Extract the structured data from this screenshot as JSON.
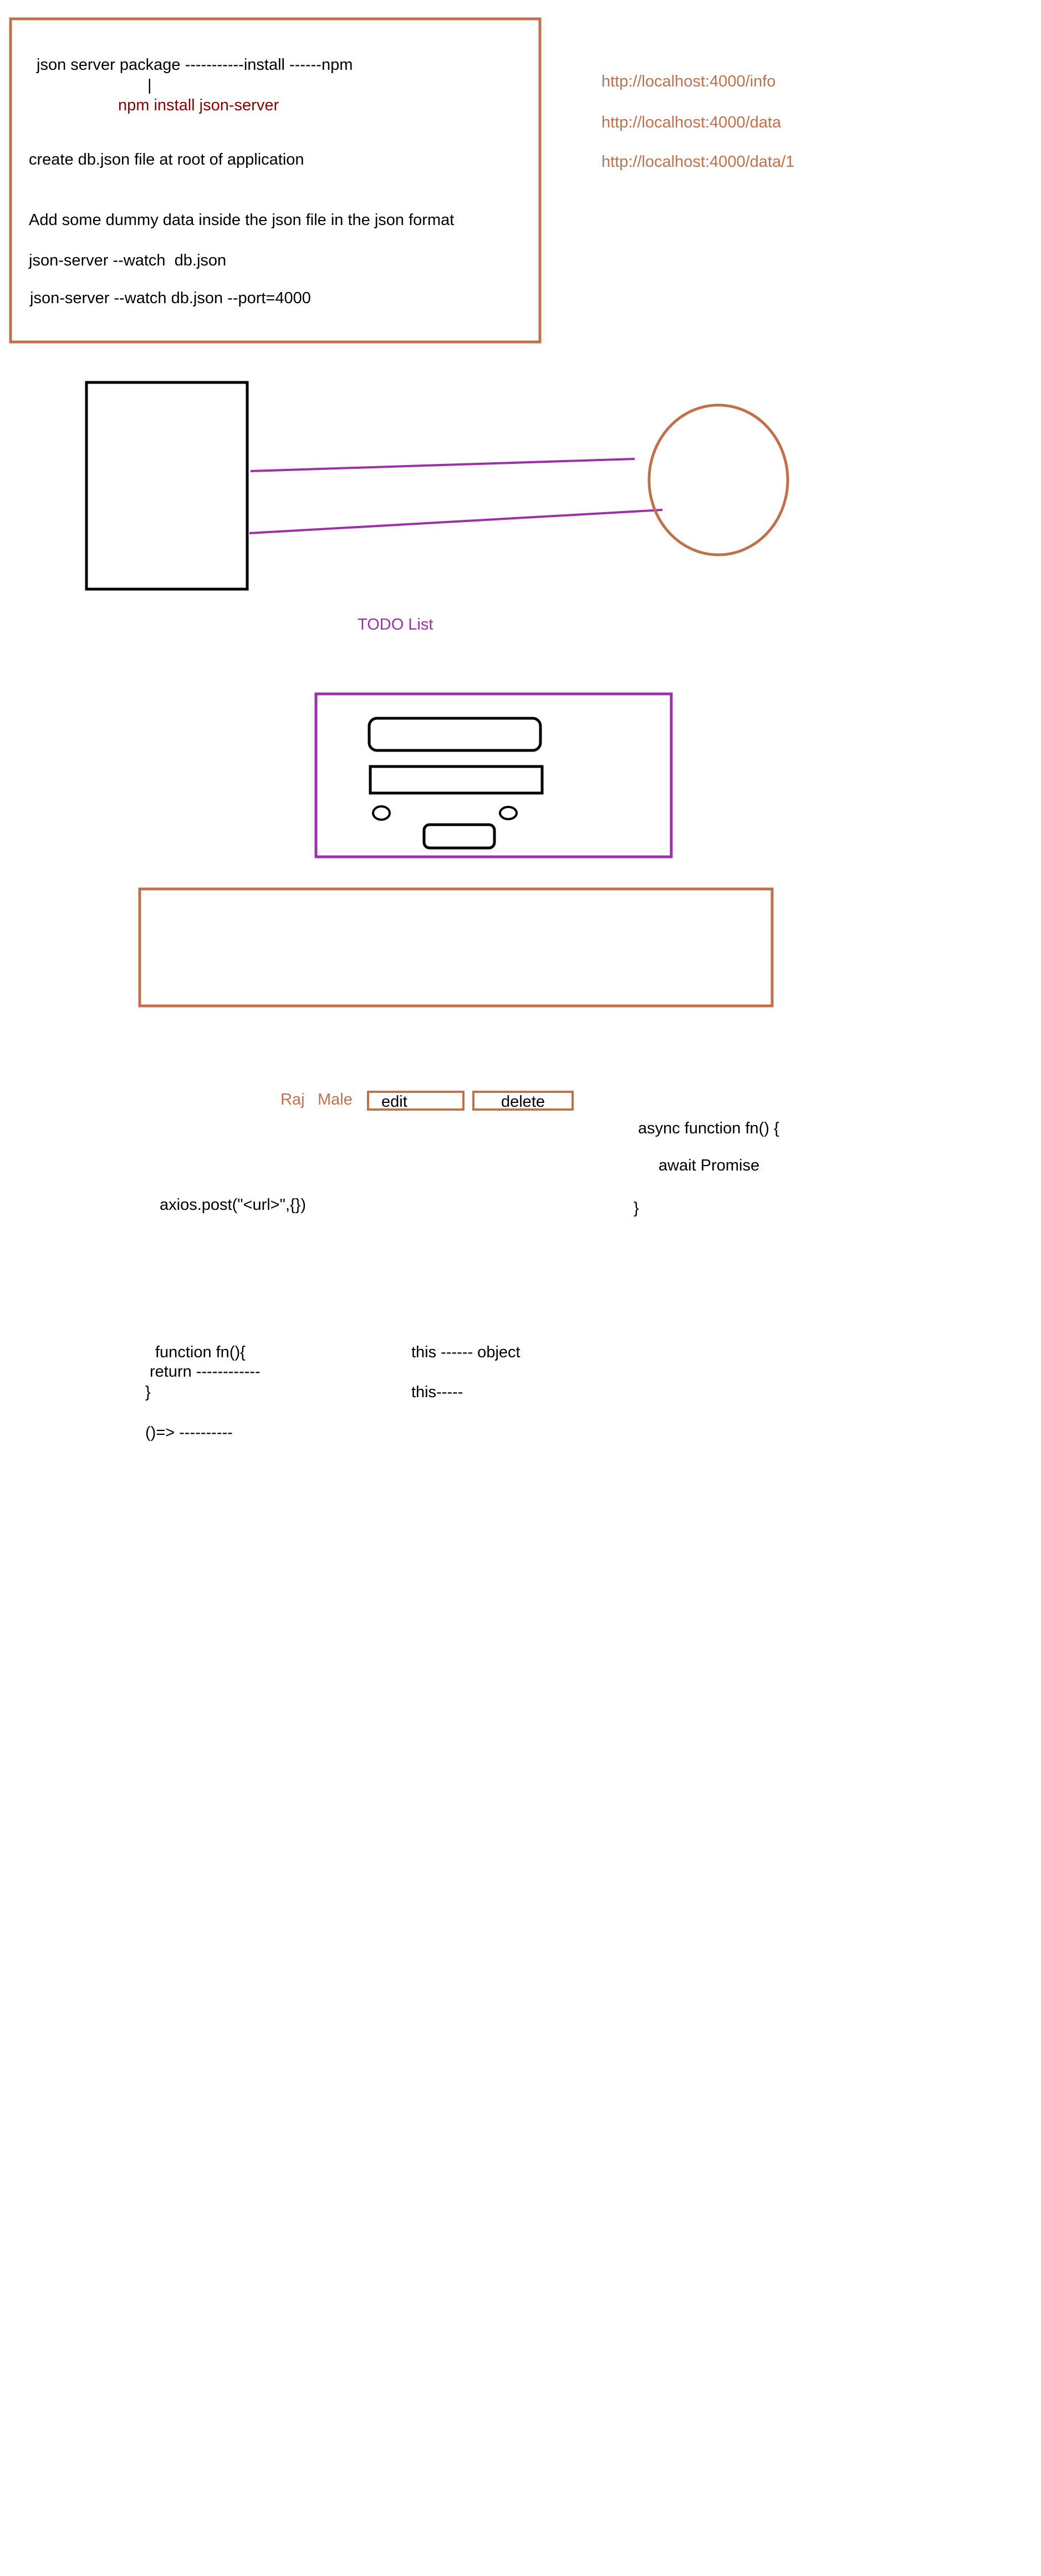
{
  "notes_box": {
    "line1": "json server package -----------install ------npm",
    "line1_pipe": "|",
    "line2": "npm install json-server",
    "line3": "create db.json file at root of application",
    "line4": "Add some dummy data inside the json file in the json format",
    "line5": "json-server --watch  db.json",
    "line6": "json-server --watch db.json --port=4000"
  },
  "urls": [
    "http://localhost:4000/info",
    "http://localhost:4000/data",
    "http://localhost:4000/data/1"
  ],
  "todo": {
    "title": "TODO List"
  },
  "row": {
    "name": "Raj",
    "gender": "Male",
    "edit_label": "edit",
    "delete_label": "delete"
  },
  "async_snippet": {
    "line1": "async function fn() {",
    "line2": "await Promise",
    "line3": "}"
  },
  "axios_snippet": "axios.post(\"<url>\",{})",
  "function_snippet": {
    "line1": "function fn(){",
    "line2": "return ------------",
    "line3": "}",
    "line4": "()=> ----------"
  },
  "this_snippet": {
    "line1": "this ------ object",
    "line2": "this-----"
  },
  "colors": {
    "orange": "#c0714a",
    "purple": "#9b30a8",
    "dark_red": "#8b0000",
    "black": "#000000"
  }
}
